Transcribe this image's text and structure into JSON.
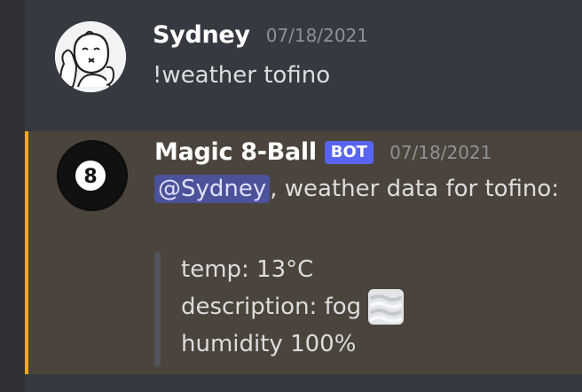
{
  "messages": [
    {
      "username": "Sydney",
      "timestamp": "07/18/2021",
      "text": "!weather tofino",
      "avatar_icon": "cartoon-face-icon"
    },
    {
      "username": "Magic 8-Ball",
      "bot_tag": "BOT",
      "timestamp": "07/18/2021",
      "mention": "@Sydney",
      "text_after_mention": ", weather data for tofino:",
      "avatar_icon": "magic-8-ball-icon",
      "accent_color": "#faa81a",
      "quote": {
        "temp": "temp: 13°C",
        "description": "description: fog",
        "humidity": "humidity 100%",
        "emoji": "fog-emoji"
      }
    }
  ],
  "colors": {
    "background": "#36393f",
    "highlight": "#4a443c",
    "bot_tag": "#5865f2"
  }
}
